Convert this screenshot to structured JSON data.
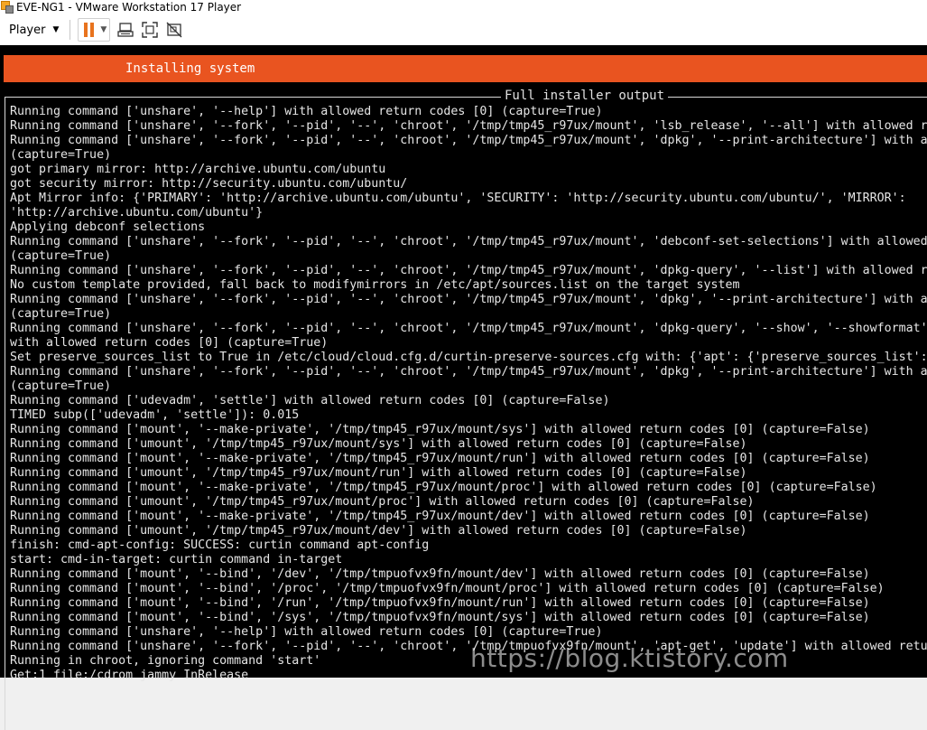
{
  "window": {
    "title": "EVE-NG1 - VMware Workstation 17 Player"
  },
  "toolbar": {
    "player_label": "Player",
    "icons": [
      "pause-icon",
      "send-ctrl-alt-del-icon",
      "fullscreen-icon",
      "unity-icon"
    ]
  },
  "installer": {
    "header": "Installing system",
    "output_title": "Full installer output"
  },
  "colors": {
    "ubuntu_orange": "#e95420",
    "pause_orange": "#e8731e",
    "console_bg": "#000000"
  },
  "log_lines": [
    "Running command ['unshare', '--help'] with allowed return codes [0] (capture=True)",
    "Running command ['unshare', '--fork', '--pid', '--', 'chroot', '/tmp/tmp45_r97ux/mount', 'lsb_release', '--all'] with allowed r",
    "Running command ['unshare', '--fork', '--pid', '--', 'chroot', '/tmp/tmp45_r97ux/mount', 'dpkg', '--print-architecture'] with a",
    "(capture=True)",
    "got primary mirror: http://archive.ubuntu.com/ubuntu",
    "got security mirror: http://security.ubuntu.com/ubuntu/",
    "Apt Mirror info: {'PRIMARY': 'http://archive.ubuntu.com/ubuntu', 'SECURITY': 'http://security.ubuntu.com/ubuntu/', 'MIRROR':",
    "'http://archive.ubuntu.com/ubuntu'}",
    "Applying debconf selections",
    "Running command ['unshare', '--fork', '--pid', '--', 'chroot', '/tmp/tmp45_r97ux/mount', 'debconf-set-selections'] with allowed",
    "(capture=True)",
    "Running command ['unshare', '--fork', '--pid', '--', 'chroot', '/tmp/tmp45_r97ux/mount', 'dpkg-query', '--list'] with allowed r",
    "No custom template provided, fall back to modifymirrors in /etc/apt/sources.list on the target system",
    "Running command ['unshare', '--fork', '--pid', '--', 'chroot', '/tmp/tmp45_r97ux/mount', 'dpkg', '--print-architecture'] with a",
    "(capture=True)",
    "Running command ['unshare', '--fork', '--pid', '--', 'chroot', '/tmp/tmp45_r97ux/mount', 'dpkg-query', '--show', '--showformat'",
    "with allowed return codes [0] (capture=True)",
    "Set preserve_sources_list to True in /etc/cloud/cloud.cfg.d/curtin-preserve-sources.cfg with: {'apt': {'preserve_sources_list':",
    "Running command ['unshare', '--fork', '--pid', '--', 'chroot', '/tmp/tmp45_r97ux/mount', 'dpkg', '--print-architecture'] with a",
    "(capture=True)",
    "Running command ['udevadm', 'settle'] with allowed return codes [0] (capture=False)",
    "TIMED subp(['udevadm', 'settle']): 0.015",
    "Running command ['mount', '--make-private', '/tmp/tmp45_r97ux/mount/sys'] with allowed return codes [0] (capture=False)",
    "Running command ['umount', '/tmp/tmp45_r97ux/mount/sys'] with allowed return codes [0] (capture=False)",
    "Running command ['mount', '--make-private', '/tmp/tmp45_r97ux/mount/run'] with allowed return codes [0] (capture=False)",
    "Running command ['umount', '/tmp/tmp45_r97ux/mount/run'] with allowed return codes [0] (capture=False)",
    "Running command ['mount', '--make-private', '/tmp/tmp45_r97ux/mount/proc'] with allowed return codes [0] (capture=False)",
    "Running command ['umount', '/tmp/tmp45_r97ux/mount/proc'] with allowed return codes [0] (capture=False)",
    "Running command ['mount', '--make-private', '/tmp/tmp45_r97ux/mount/dev'] with allowed return codes [0] (capture=False)",
    "Running command ['umount', '/tmp/tmp45_r97ux/mount/dev'] with allowed return codes [0] (capture=False)",
    "finish: cmd-apt-config: SUCCESS: curtin command apt-config",
    "start: cmd-in-target: curtin command in-target",
    "Running command ['mount', '--bind', '/dev', '/tmp/tmpuofvx9fn/mount/dev'] with allowed return codes [0] (capture=False)",
    "Running command ['mount', '--bind', '/proc', '/tmp/tmpuofvx9fn/mount/proc'] with allowed return codes [0] (capture=False)",
    "Running command ['mount', '--bind', '/run', '/tmp/tmpuofvx9fn/mount/run'] with allowed return codes [0] (capture=False)",
    "Running command ['mount', '--bind', '/sys', '/tmp/tmpuofvx9fn/mount/sys'] with allowed return codes [0] (capture=False)",
    "Running command ['unshare', '--help'] with allowed return codes [0] (capture=True)",
    "Running command ['unshare', '--fork', '--pid', '--', 'chroot', '/tmp/tmpuofvx9fn/mount', 'apt-get', 'update'] with allowed retu",
    "Running in chroot, ignoring command 'start'",
    "Get:1 file:/cdrom jammy InRelease"
  ],
  "watermark": "https://blog.ktistory.com"
}
